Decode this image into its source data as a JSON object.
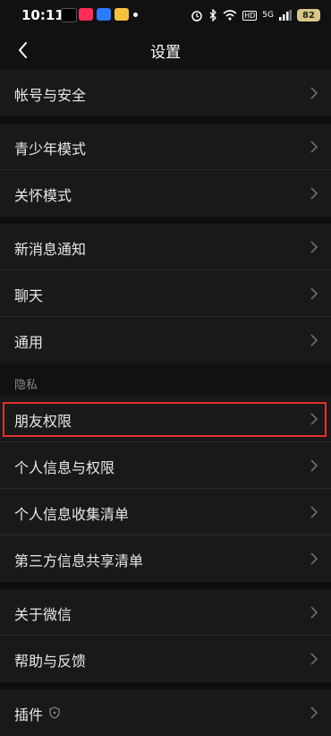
{
  "status_bar": {
    "time": "10:11",
    "network_badge": "HD",
    "signal_label": "5G",
    "battery": "82",
    "app_icon_colors": [
      "#ff2d55",
      "#2b7bff",
      "#f6c23e"
    ]
  },
  "header": {
    "title": "设置",
    "back_icon": "chevron-left-icon"
  },
  "groups": [
    {
      "items": [
        {
          "label": "帐号与安全"
        }
      ]
    },
    {
      "items": [
        {
          "label": "青少年模式"
        },
        {
          "label": "关怀模式"
        }
      ]
    },
    {
      "items": [
        {
          "label": "新消息通知"
        },
        {
          "label": "聊天"
        },
        {
          "label": "通用"
        }
      ]
    },
    {
      "section_title": "隐私",
      "items": [
        {
          "label": "朋友权限",
          "highlighted": true
        },
        {
          "label": "个人信息与权限"
        },
        {
          "label": "个人信息收集清单"
        },
        {
          "label": "第三方信息共享清单"
        }
      ]
    },
    {
      "items": [
        {
          "label": "关于微信"
        },
        {
          "label": "帮助与反馈"
        }
      ]
    },
    {
      "items": [
        {
          "label": "插件",
          "icon": "shield-icon"
        }
      ]
    }
  ],
  "colors": {
    "highlight_border": "#e0312e",
    "row_background": "#191919",
    "page_background": "#111111"
  }
}
